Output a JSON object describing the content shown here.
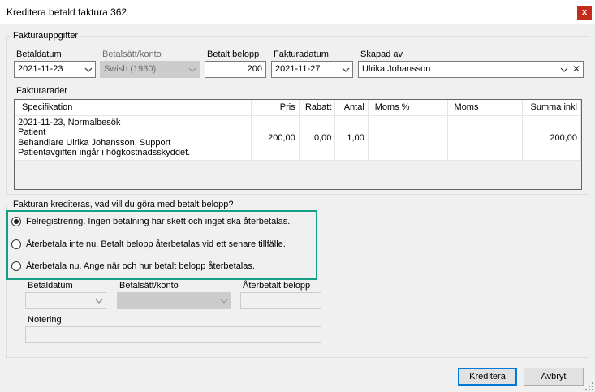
{
  "window": {
    "title": "Kreditera betald faktura 362",
    "close_label": "x"
  },
  "invoice": {
    "group_title": "Fakturauppgifter",
    "betaldatum": {
      "label": "Betaldatum",
      "value": "2021-11-23"
    },
    "betalsatt": {
      "label": "Betalsätt/konto",
      "value": "Swish (1930)"
    },
    "belopp": {
      "label": "Betalt belopp",
      "value": "200"
    },
    "fakturadatum": {
      "label": "Fakturadatum",
      "value": "2021-11-27"
    },
    "skapad_av": {
      "label": "Skapad av",
      "value": "Ulrika Johansson"
    }
  },
  "rows_section": {
    "title": "Fakturarader",
    "columns": [
      "Specifikation",
      "Pris",
      "Rabatt",
      "Antal",
      "Moms %",
      "Moms",
      "Summa inkl"
    ],
    "rows": [
      {
        "spec": [
          "2021-11-23, Normalbesök",
          "Patient",
          "Behandlare Ulrika Johansson, Support",
          "Patientavgiften ingår i högkostnadsskyddet."
        ],
        "pris": "200,00",
        "rabatt": "0,00",
        "antal": "1,00",
        "moms_pct": "",
        "moms": "",
        "summa": "200,00"
      }
    ]
  },
  "credit": {
    "question": "Fakturan krediteras, vad vill du göra med betalt belopp?",
    "options": [
      {
        "label": "Felregistrering. Ingen betalning har skett och inget ska återbetalas.",
        "selected": true
      },
      {
        "label": "Återbetala inte nu. Betalt belopp återbetalas vid ett senare tillfälle.",
        "selected": false
      },
      {
        "label": "Återbetala nu. Ange när och hur betalt belopp återbetalas.",
        "selected": false
      }
    ],
    "refund": {
      "betaldatum_label": "Betaldatum",
      "betalsatt_label": "Betalsätt/konto",
      "aterbetalt_label": "Återbetalt belopp",
      "notering_label": "Notering"
    },
    "highlight_color": "#14a085"
  },
  "buttons": {
    "kreditera": "Kreditera",
    "avbryt": "Avbryt"
  },
  "icons": [
    "close-icon",
    "chevron-down-icon",
    "clear-icon",
    "radio-selected-icon",
    "size-grip-icon"
  ]
}
